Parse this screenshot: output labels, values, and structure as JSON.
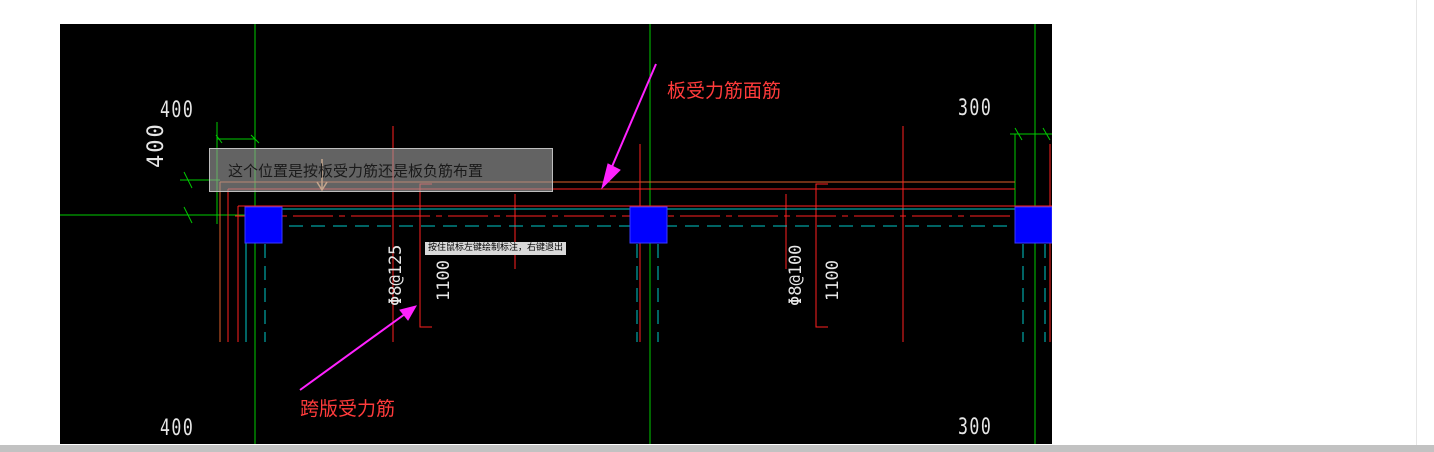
{
  "drawing": {
    "dimensions": {
      "top_left": "400",
      "top_left_vertical": "400",
      "top_right": "300",
      "bottom_left": "400",
      "bottom_right": "300"
    },
    "rebar_labels": {
      "left_spacing": "Φ8@125",
      "left_length": "1100",
      "right_spacing": "Φ8@100",
      "right_length": "1100"
    },
    "annotations": {
      "top_rebar": "板受力筋面筋",
      "span_rebar": "跨版受力筋"
    },
    "question_tooltip": "这个位置是按板受力筋还是板负筋布置",
    "command_hint": "按住鼠标左键绘制标注，右键退出",
    "colors": {
      "background": "#000000",
      "green_axis": "#00cc00",
      "red_line": "#ff2020",
      "cyan_line": "#00c8c8",
      "column_blue": "#0000ff",
      "arrow_magenta": "#ff22ff"
    }
  }
}
